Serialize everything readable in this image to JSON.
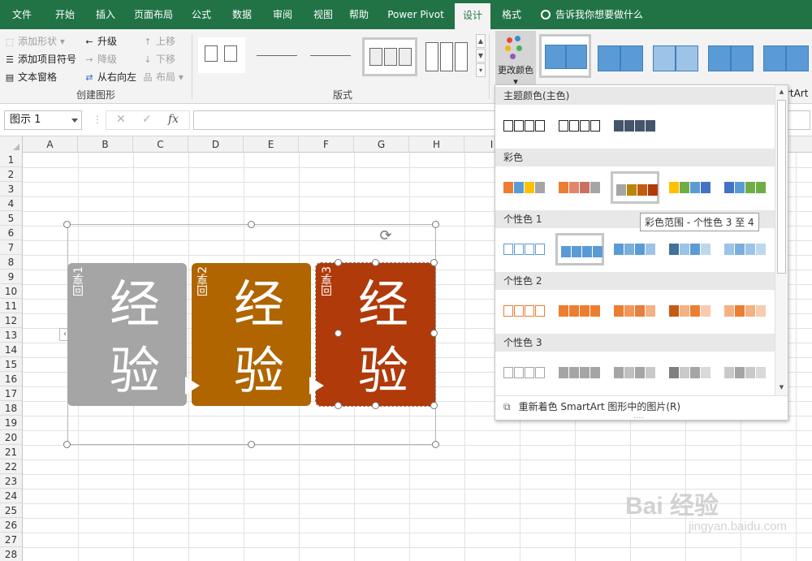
{
  "tabs": [
    "文件",
    "开始",
    "插入",
    "页面布局",
    "公式",
    "数据",
    "审阅",
    "视图",
    "帮助",
    "Power Pivot",
    "设计",
    "格式"
  ],
  "active_tab": "设计",
  "tell_me": "告诉我你想要做什么",
  "create_graphic": {
    "add_shape": "添加形状",
    "add_bullet": "添加项目符号",
    "text_pane": "文本窗格",
    "promote": "升级",
    "demote": "降级",
    "right_to_left": "从右向左",
    "move_up": "上移",
    "move_down": "下移",
    "layout": "布局",
    "group_label": "创建图形"
  },
  "layouts_group_label": "版式",
  "change_colors_label": "更改颜色",
  "ribbon_clipped_text": "rtArt",
  "name_box": "图示 1",
  "formula_icons": {
    "cancel": "✕",
    "enter": "✓",
    "fx": "fx"
  },
  "columns": [
    "A",
    "B",
    "C",
    "D",
    "E",
    "F",
    "G",
    "H",
    "I"
  ],
  "rows": [
    "1",
    "2",
    "3",
    "4",
    "5",
    "6",
    "7",
    "8",
    "9",
    "10",
    "11",
    "12",
    "13",
    "14",
    "15",
    "16",
    "17",
    "18",
    "19",
    "20",
    "21",
    "22",
    "23",
    "24",
    "25",
    "26",
    "27",
    "28"
  ],
  "smartart": {
    "boxes": [
      {
        "title": "回享1",
        "text": "经验",
        "color": "#a5a5a5"
      },
      {
        "title": "回享2",
        "text": "经验",
        "color": "#b06500"
      },
      {
        "title": "回享3",
        "text": "经验",
        "color": "#b03a0a"
      }
    ]
  },
  "dropdown": {
    "sections": [
      {
        "label": "主题颜色(主色)"
      },
      {
        "label": "彩色"
      },
      {
        "label": "个性色 1"
      },
      {
        "label": "个性色 2"
      },
      {
        "label": "个性色 3"
      }
    ],
    "tooltip": "彩色范围 - 个性色 3 至 4",
    "recolor_label": "重新着色 SmartArt 图形中的图片(R)"
  },
  "colors": {
    "excel_green": "#217346",
    "accent_blue": "#5b9bd5",
    "accent_orange": "#ed7d31",
    "accent_gray": "#a5a5a5"
  },
  "watermark": {
    "brand": "Bai 经验",
    "url": "jingyan.baidu.com"
  }
}
